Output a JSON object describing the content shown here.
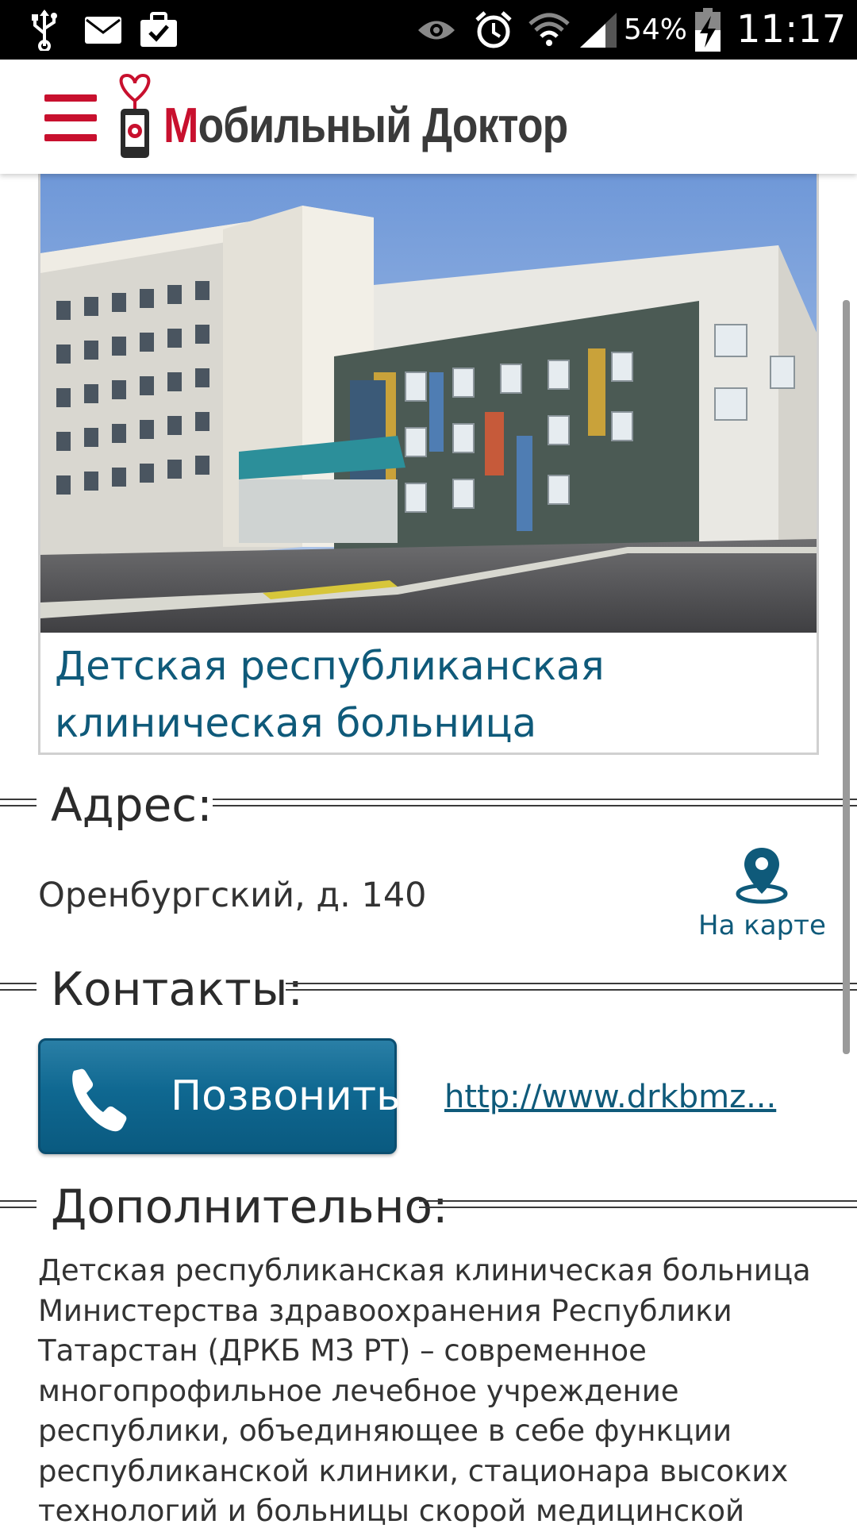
{
  "status_bar": {
    "battery_percent": "54%",
    "time": "11:17",
    "icons": [
      "usb-icon",
      "email-icon",
      "briefcase-check-icon",
      "eye-icon",
      "alarm-icon",
      "wifi-icon",
      "signal-icon",
      "battery-charging-icon"
    ]
  },
  "header": {
    "logo_accent": "М",
    "logo_rest": "обильный Доктор",
    "brand_color": "#c8102e"
  },
  "hospital": {
    "title_line1": "Детская республиканская",
    "title_line2": "клиническая больница",
    "title_color": "#0f5a7a"
  },
  "address_section": {
    "label": "Адрес:",
    "address": "Оренбургский, д. 140",
    "map_link_label": "На карте"
  },
  "contacts_section": {
    "label": "Контакты:",
    "call_button_label": "Позвонить",
    "website": "http://www.drkbmz..."
  },
  "extra_section": {
    "label": "Дополнительно:",
    "lines": [
      "Детская республиканская клиническая больница",
      "Министерства здравоохранения Республики",
      "Татарстан (ДРКБ МЗ РТ) – современное",
      "многопрофильное лечебное учреждение",
      "республики, объединяющее в себе функции",
      "республиканской клиники, стационара высоких",
      "технологий и больницы скорой медицинской"
    ]
  }
}
